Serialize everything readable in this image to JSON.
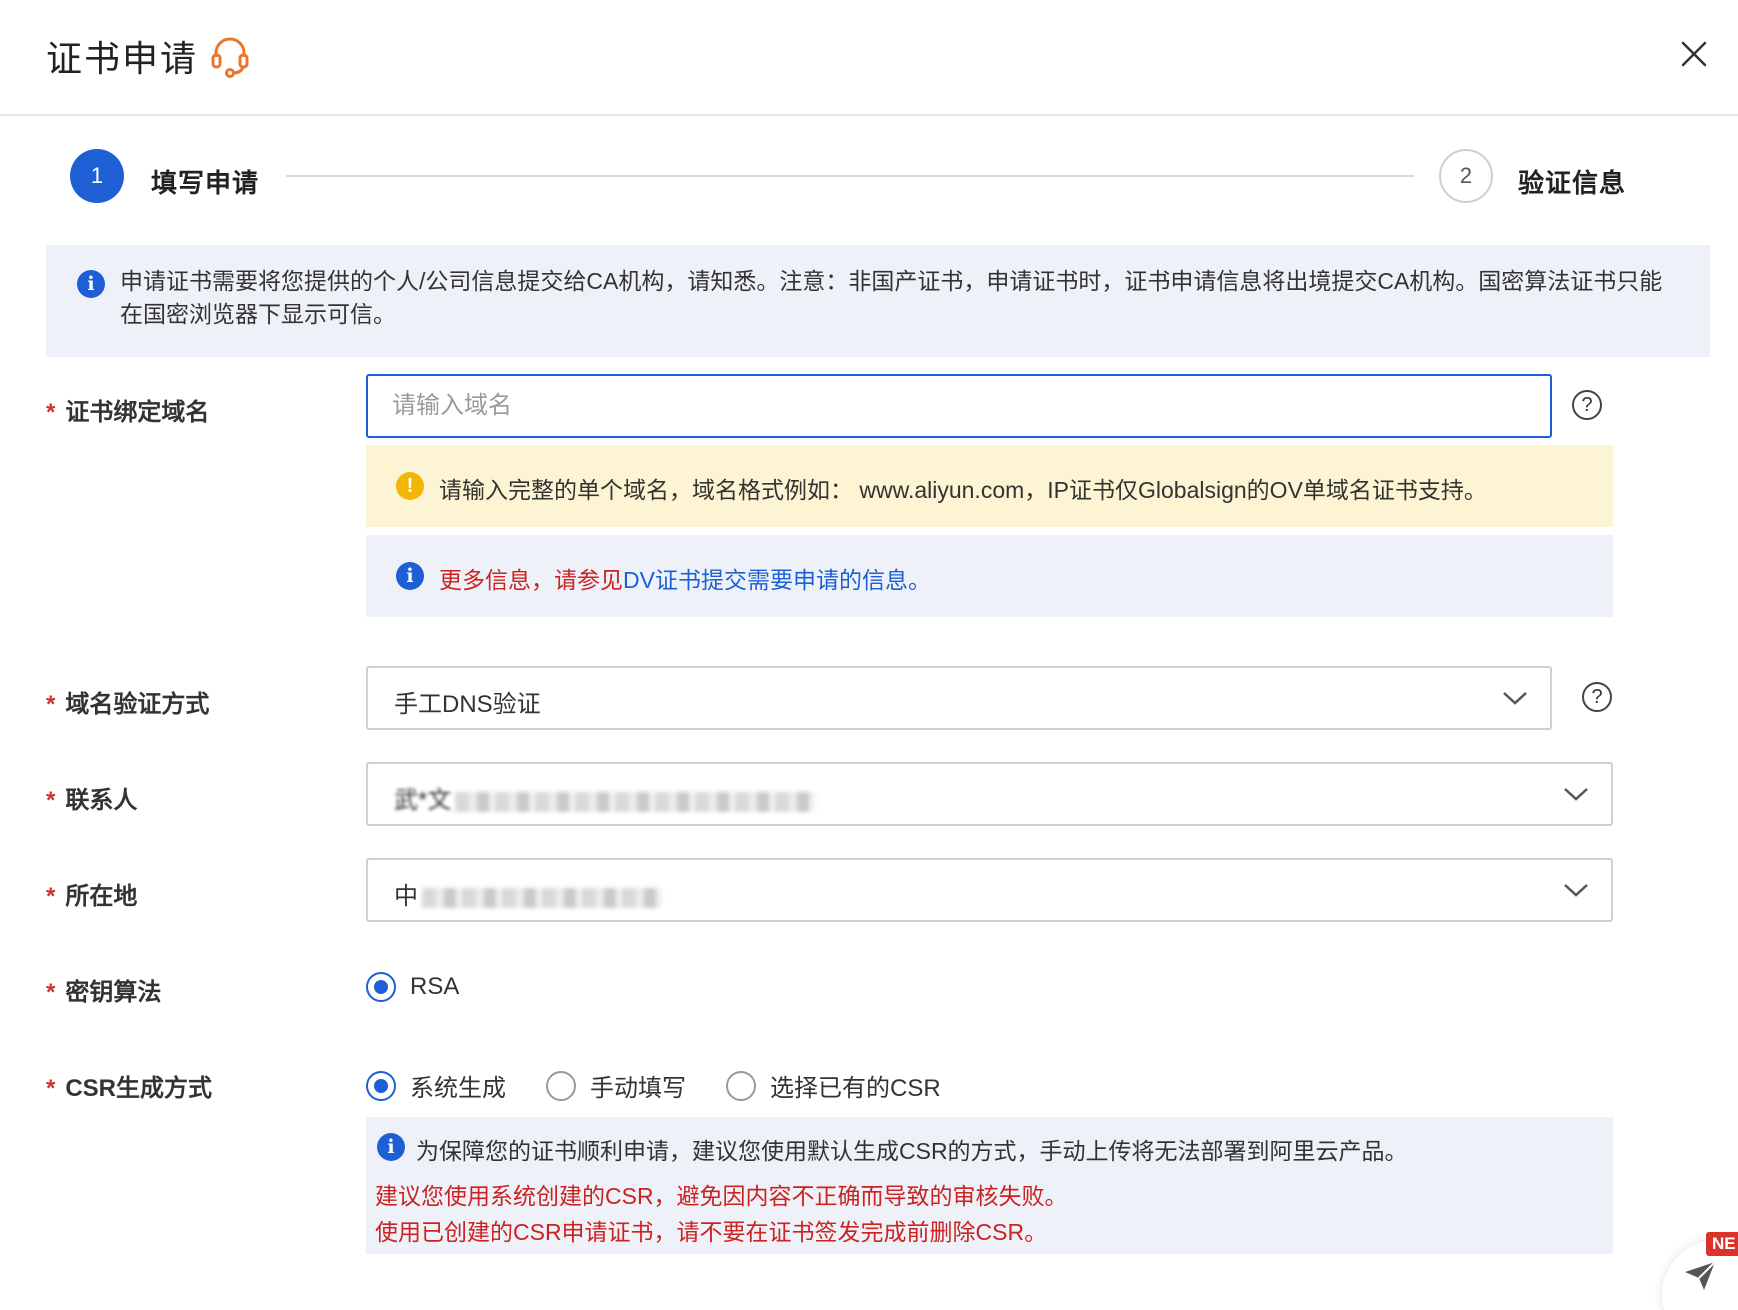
{
  "header": {
    "title": "证书申请",
    "support_icon": "headset-icon",
    "close_icon": "close-icon"
  },
  "steps": [
    {
      "number": "1",
      "label": "填写申请",
      "active": true
    },
    {
      "number": "2",
      "label": "验证信息",
      "active": false
    }
  ],
  "notice": {
    "icon": "info-icon",
    "text": "申请证书需要将您提供的个人/公司信息提交给CA机构，请知悉。注意：非国产证书，申请证书时，证书申请信息将出境提交CA机构。国密算法证书只能在国密浏览器下显示可信。"
  },
  "form": {
    "required_mark": "*",
    "domain": {
      "label": "证书绑定域名",
      "placeholder": "请输入域名",
      "value": "",
      "warning": "请输入完整的单个域名，域名格式例如： www.aliyun.com，IP证书仅Globalsign的OV单域名证书支持。",
      "info_prefix": "更多信息，请参见",
      "info_link": "DV证书提交需要申请的信息",
      "info_suffix": "。"
    },
    "verify_method": {
      "label": "域名验证方式",
      "value": "手工DNS验证"
    },
    "contact": {
      "label": "联系人",
      "value_visible": "武*文"
    },
    "location": {
      "label": "所在地",
      "value_visible": "中"
    },
    "key_algorithm": {
      "label": "密钥算法",
      "options": [
        {
          "label": "RSA",
          "checked": true
        }
      ]
    },
    "csr": {
      "label": "CSR生成方式",
      "options": [
        {
          "label": "系统生成",
          "checked": true
        },
        {
          "label": "手动填写",
          "checked": false
        },
        {
          "label": "选择已有的CSR",
          "checked": false
        }
      ],
      "tip": "为保障您的证书顺利申请，建议您使用默认生成CSR的方式，手动上传将无法部署到阿里云产品。",
      "warn1": "建议您使用系统创建的CSR，避免因内容不正确而导致的审核失败。",
      "warn2": "使用已创建的CSR申请证书，请不要在证书签发完成前删除CSR。"
    }
  },
  "floating": {
    "badge": "NE",
    "icon": "paper-plane-icon"
  },
  "colors": {
    "primary": "#1e5fd6",
    "warning_bg": "#fdf4d3",
    "info_bg": "#eef2f8",
    "danger": "#cc2222",
    "accent_orange": "#e8772e"
  }
}
